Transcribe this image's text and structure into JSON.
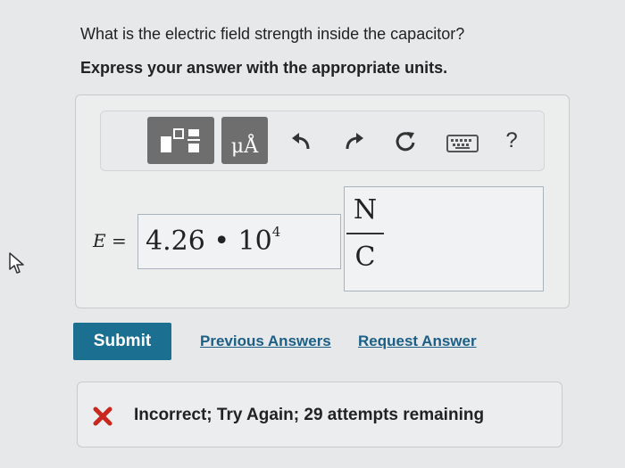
{
  "question": {
    "text": "What is the electric field strength inside the capacitor?",
    "instruction": "Express your answer with the appropriate units."
  },
  "toolbar": {
    "templates_icon": "templates-icon",
    "units_glyph": "μÅ",
    "undo_icon": "undo-icon",
    "redo_icon": "redo-icon",
    "reset_icon": "reset-icon",
    "keyboard_icon": "keyboard-icon",
    "help_label": "?"
  },
  "answer": {
    "variable": "E",
    "equals": "=",
    "mantissa": "4.26",
    "times": "•",
    "base": "10",
    "exponent": "4",
    "unit_numerator": "N",
    "unit_denominator": "C"
  },
  "actions": {
    "submit_label": "Submit",
    "previous_answers_label": "Previous Answers",
    "request_answer_label": "Request Answer"
  },
  "feedback": {
    "status_icon": "x-icon",
    "status_color": "#c8281e",
    "message": "Incorrect; Try Again; 29 attempts remaining"
  },
  "colors": {
    "accent": "#1b6f91",
    "link": "#1c5f86",
    "toolbar_button": "#6e6e6e"
  }
}
